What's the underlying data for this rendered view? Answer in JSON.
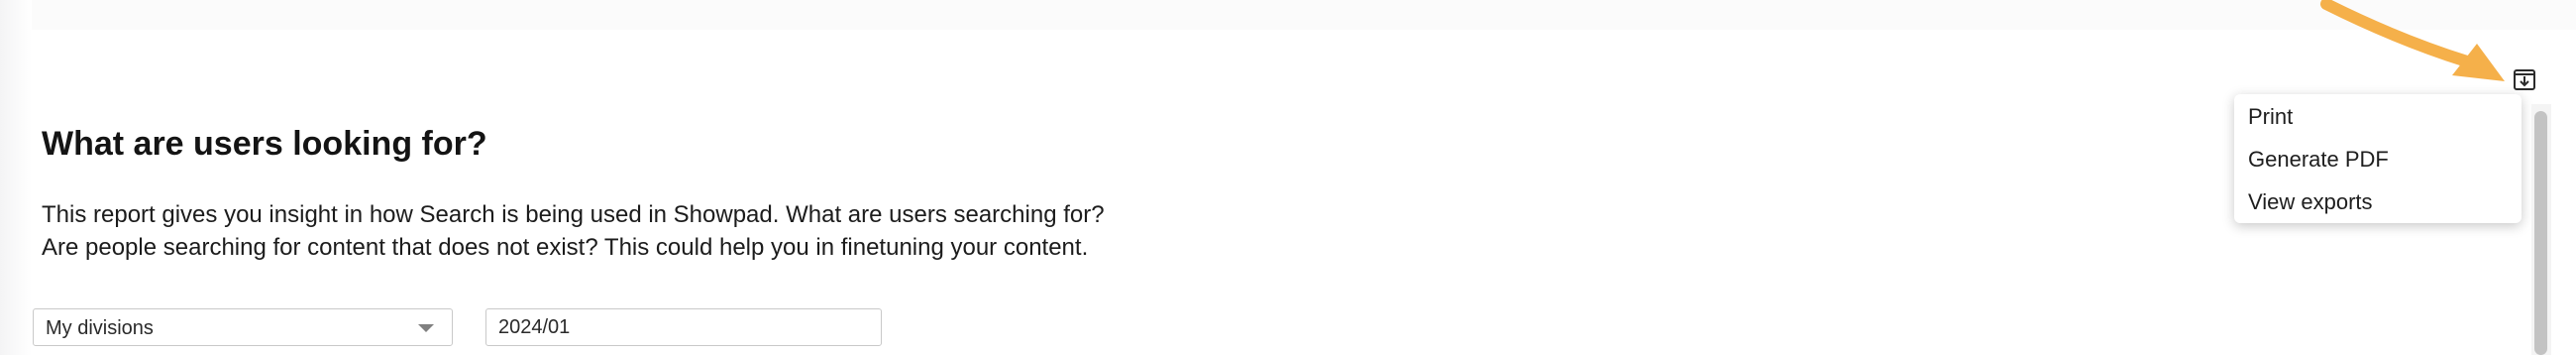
{
  "page": {
    "title": "What are users looking for?",
    "description_line1": "This report gives you insight in how Search is being used in Showpad. What are users searching for?",
    "description_line2": "Are people searching for content that does not exist? This could help you in finetuning your content."
  },
  "filters": {
    "division_value": "My divisions",
    "date_value": "2024/01"
  },
  "export_menu": {
    "icon": "download-icon",
    "items": [
      {
        "label": "Print"
      },
      {
        "label": "Generate PDF"
      },
      {
        "label": "View exports"
      }
    ]
  },
  "colors": {
    "annotation_arrow": "#f5b04a",
    "text": "#1f1f1f",
    "border": "#c9c9c9"
  }
}
